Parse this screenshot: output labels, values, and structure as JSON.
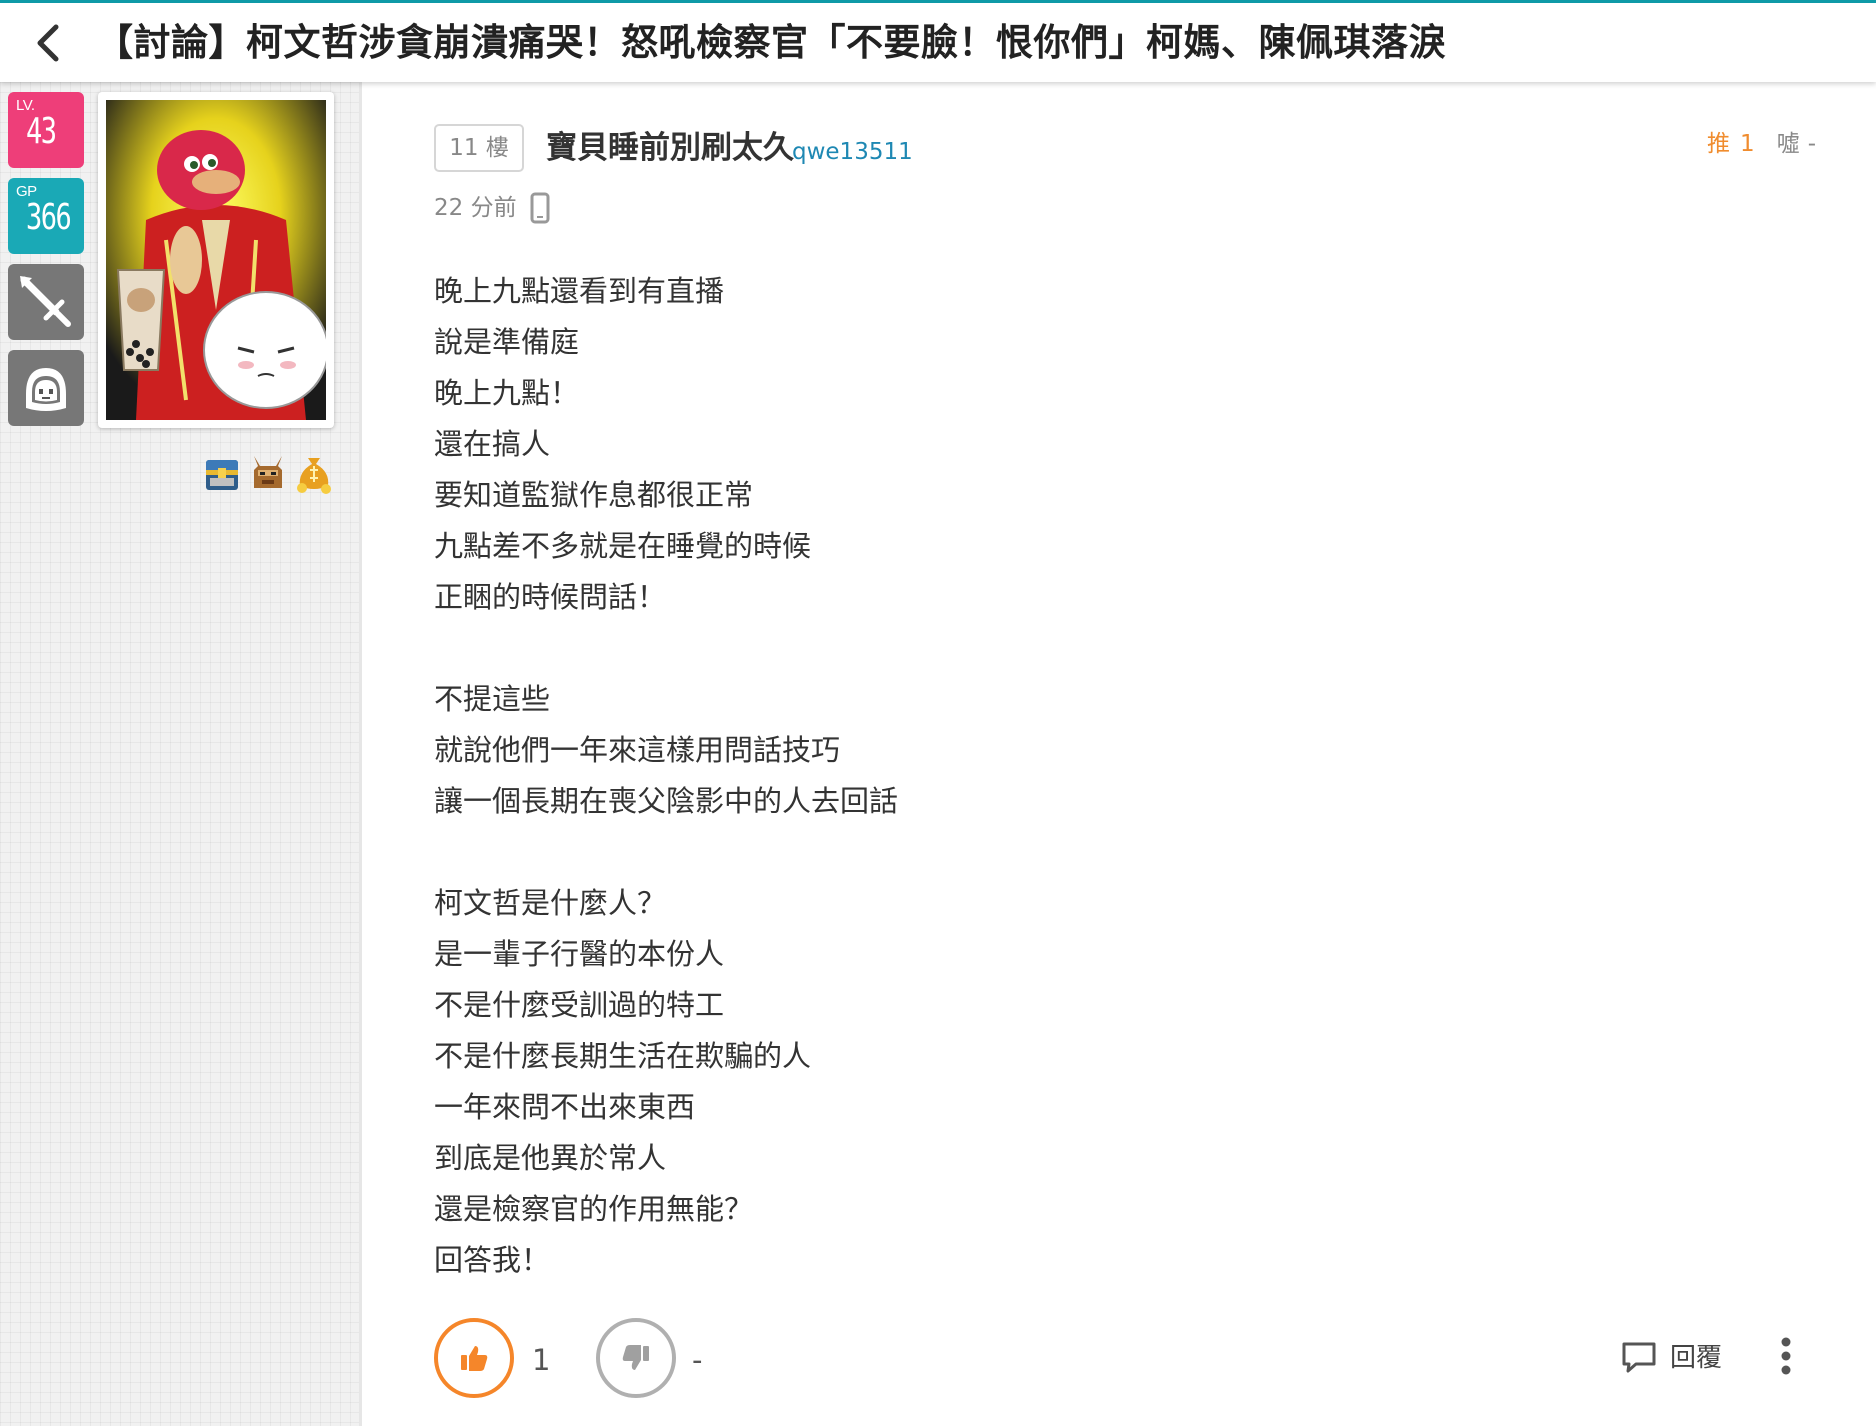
{
  "header": {
    "back_icon": "chevron-left-icon",
    "title": "【討論】柯文哲涉貪崩潰痛哭！怒吼檢察官「不要臉！恨你們」柯媽、陳佩琪落淚",
    "accent_color": "#0e9aa7"
  },
  "sidebar": {
    "level": {
      "caption": "LV.",
      "value": "43",
      "color": "#ee3e79"
    },
    "gp": {
      "caption": "GP",
      "value": "366",
      "color": "#1aa9b6"
    },
    "sword_icon": "sword-icon",
    "character_icon": "character-face-icon",
    "avatar": "user-avatar-illustration",
    "small_icons": [
      "treasure-chest-icon",
      "horned-mask-icon",
      "gold-bag-icon"
    ]
  },
  "post": {
    "floor": "11 樓",
    "author_nick": "寶貝睡前別刷太久",
    "author_id": "qwe13511",
    "push_label": "推",
    "push_count": "1",
    "boo_label": "噓",
    "boo_count": "-",
    "time": "22 分前",
    "device_icon": "mobile-phone-icon",
    "lines": [
      "晚上九點還看到有直播",
      "說是準備庭",
      "晚上九點！",
      "還在搞人",
      "要知道監獄作息都很正常",
      "九點差不多就是在睡覺的時候",
      "正睏的時候問話！",
      "",
      "不提這些",
      "就說他們一年來這樣用問話技巧",
      "讓一個長期在喪父陰影中的人去回話",
      "",
      "柯文哲是什麼人？",
      "是一輩子行醫的本份人",
      "不是什麼受訓過的特工",
      "不是什麼長期生活在欺騙的人",
      "一年來問不出來東西",
      "到底是他異於常人",
      "還是檢察官的作用無能？",
      "回答我！"
    ]
  },
  "actions": {
    "like_count": "1",
    "dislike_count": "-",
    "reply_label": "回覆",
    "like_color": "#f5862a",
    "dislike_color": "#b0b0b0"
  }
}
